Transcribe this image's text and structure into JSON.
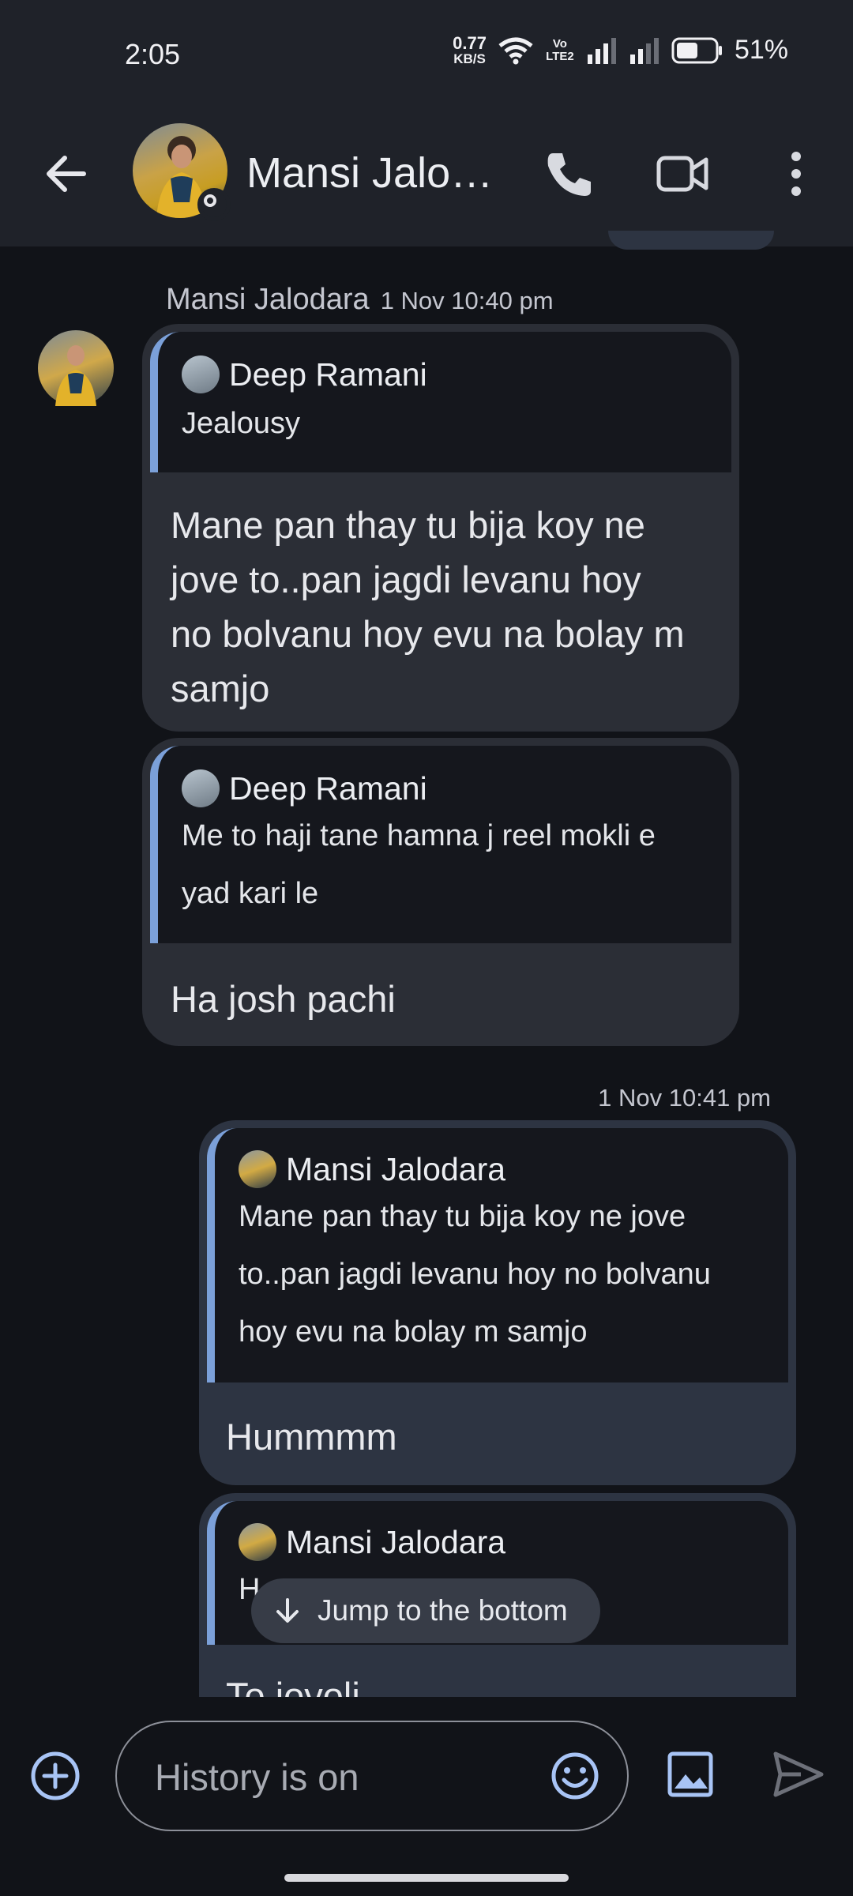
{
  "status_bar": {
    "time": "2:05",
    "speed_value": "0.77",
    "speed_unit": "KB/S",
    "volte": "Vo LTE2",
    "battery_percent": "51%"
  },
  "app_bar": {
    "title": "Mansi Jalo…",
    "icons": [
      "back-arrow-icon",
      "phone-icon",
      "video-camera-icon",
      "more-vert-icon"
    ]
  },
  "messages": {
    "incoming_header": {
      "sender": "Mansi Jalodara",
      "timestamp": "1 Nov 10:40 pm"
    },
    "incoming": [
      {
        "quote_author": "Deep Ramani",
        "quote_text": "Jealousy",
        "lines": [
          "Mane pan thay tu bija koy ne",
          "jove to..pan jagdi levanu hoy",
          "no bolvanu hoy evu na bolay m",
          "samjo"
        ]
      },
      {
        "quote_author": "Deep Ramani",
        "quote_lines": [
          "Me to haji tane hamna j reel mokli e",
          "yad kari le"
        ],
        "text": "Ha josh pachi"
      }
    ],
    "outgoing_timestamp": "1 Nov 10:41 pm",
    "outgoing": [
      {
        "quote_author": "Mansi Jalodara",
        "quote_lines": [
          "Mane pan thay tu bija koy ne jove",
          "to..pan jagdi levanu hoy no bolvanu",
          "hoy evu na bolay m samjo"
        ],
        "text": "Hummmm"
      },
      {
        "quote_author": "Mansi Jalodara",
        "quote_partial": "H",
        "text_partial": "To joyoli"
      }
    ]
  },
  "jump_button": {
    "label": "Jump to the bottom"
  },
  "compose": {
    "placeholder": "History is on"
  },
  "colors": {
    "background": "#111318",
    "bar": "#1f2229",
    "incoming_bubble": "#2b2e36",
    "outgoing_bubble": "#2d3442",
    "quote_accent": "#7ba0d9"
  }
}
